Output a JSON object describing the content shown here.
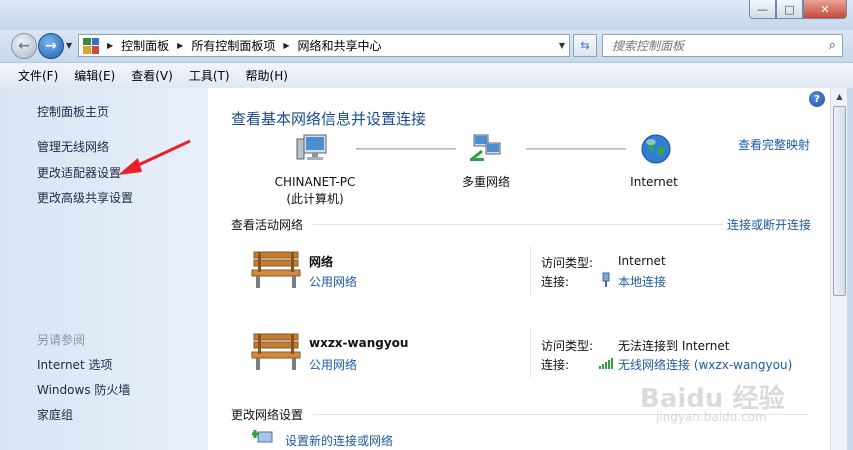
{
  "window": {
    "minimize_glyph": "—",
    "maximize_glyph": "□",
    "close_glyph": "✕"
  },
  "nav": {
    "back_glyph": "←",
    "forward_glyph": "→",
    "breadcrumb": [
      "控制面板",
      "所有控制面板项",
      "网络和共享中心"
    ],
    "refresh_glyph": "⇆",
    "search_placeholder": "搜索控制面板",
    "search_glyph": "⌕"
  },
  "menu": [
    "文件(F)",
    "编辑(E)",
    "查看(V)",
    "工具(T)",
    "帮助(H)"
  ],
  "sidebar": {
    "links": [
      "控制面板主页",
      "管理无线网络",
      "更改适配器设置",
      "更改高级共享设置"
    ],
    "see_also_header": "另请参阅",
    "see_also": [
      "Internet 选项",
      "Windows 防火墙",
      "家庭组"
    ]
  },
  "main": {
    "help_glyph": "?",
    "title": "查看基本网络信息并设置连接",
    "view_full_map": "查看完整映射",
    "map_nodes": [
      {
        "line1": "CHINANET-PC",
        "line2": "(此计算机)",
        "icon": "computer-icon"
      },
      {
        "line1": "多重网络",
        "line2": "",
        "icon": "network-icon"
      },
      {
        "line1": "Internet",
        "line2": "",
        "icon": "globe-icon"
      }
    ],
    "active_networks_header": "查看活动网络",
    "connect_disconnect": "连接或断开连接",
    "networks": [
      {
        "name": "网络",
        "type": "公用网络",
        "access_label": "访问类型:",
        "access_value": "Internet",
        "conn_label": "连接:",
        "conn_value": "本地连接",
        "conn_icon": "ethernet-icon"
      },
      {
        "name": "wxzx-wangyou",
        "type": "公用网络",
        "access_label": "访问类型:",
        "access_value": "无法连接到 Internet",
        "conn_label": "连接:",
        "conn_value": "无线网络连接 (wxzx-wangyou)",
        "conn_icon": "wifi-signal-icon"
      }
    ],
    "change_settings_header": "更改网络设置",
    "setup_new_connection": "设置新的连接或网络"
  },
  "watermark": {
    "text": "Baidu 经验",
    "sub": "jingyan.baidu.com"
  },
  "colors": {
    "link": "#1c5aa5",
    "title": "#1c4b8f",
    "annotation_arrow": "#e8202a"
  }
}
